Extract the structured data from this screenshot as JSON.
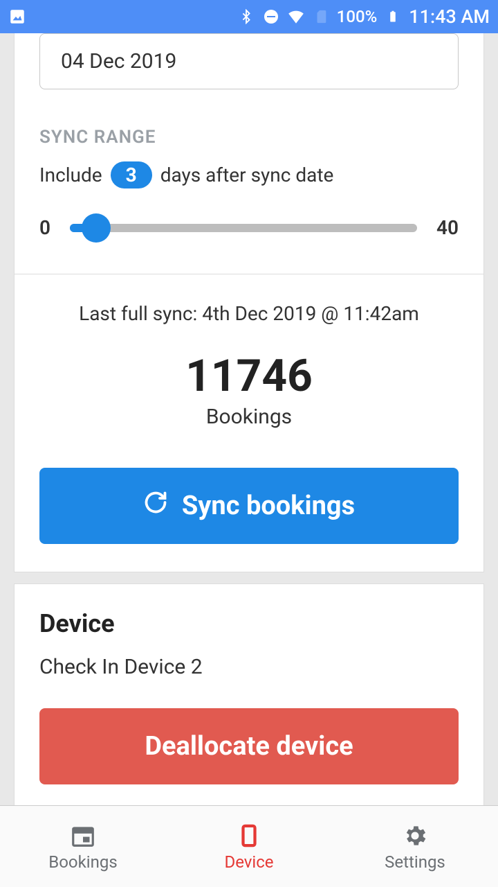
{
  "status": {
    "battery": "100%",
    "time": "11:43 AM"
  },
  "date_value": "04 Dec 2019",
  "sync_range_label": "SYNC RANGE",
  "include_prefix": "Include",
  "include_days": "3",
  "include_suffix": "days after sync date",
  "slider": {
    "min": "0",
    "max": "40"
  },
  "last_sync": "Last full sync: 4th Dec 2019 @ 11:42am",
  "bookings_count": "11746",
  "bookings_label": "Bookings",
  "sync_button": "Sync bookings",
  "device_heading": "Device",
  "device_name": "Check In Device 2",
  "deallocate_button": "Deallocate device",
  "nav": {
    "bookings": "Bookings",
    "device": "Device",
    "settings": "Settings"
  }
}
